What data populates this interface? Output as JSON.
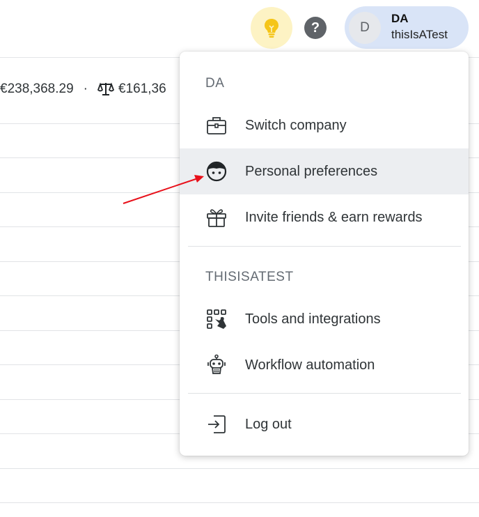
{
  "header": {
    "help_label": "?",
    "account": {
      "avatar_letter": "D",
      "initials": "DA",
      "company": "thisIsATest"
    }
  },
  "page": {
    "total_amount": "€238,368.29",
    "separator": "·",
    "balance_amount": "€161,36"
  },
  "menu": {
    "personal_section": {
      "title": "DA",
      "items": [
        {
          "label": "Switch company",
          "icon": "briefcase-icon"
        },
        {
          "label": "Personal preferences",
          "icon": "person-face-icon",
          "active": true
        },
        {
          "label": "Invite friends & earn rewards",
          "icon": "gift-icon"
        }
      ]
    },
    "company_section": {
      "title": "THISISATEST",
      "items": [
        {
          "label": "Tools and integrations",
          "icon": "tools-icon"
        },
        {
          "label": "Workflow automation",
          "icon": "robot-icon"
        }
      ]
    },
    "logout": {
      "label": "Log out",
      "icon": "logout-icon"
    }
  },
  "colors": {
    "accent_bulb_bg": "#fdf3c4",
    "bulb": "#f5c518",
    "account_pill_bg": "#d9e4f7",
    "active_item_bg": "#eceef1",
    "annotation_arrow": "#e8101a"
  }
}
